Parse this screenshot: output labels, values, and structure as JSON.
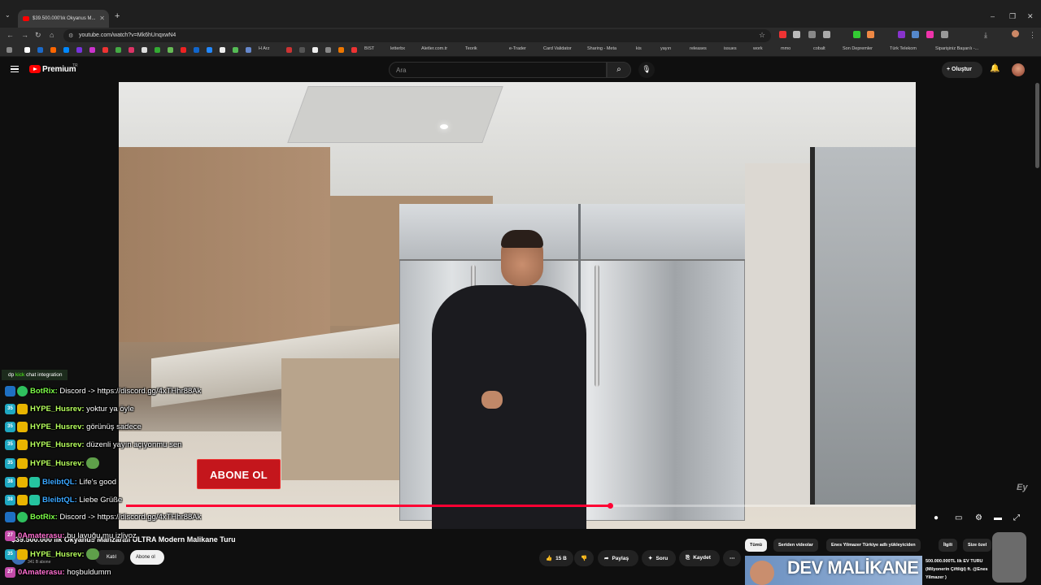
{
  "browser": {
    "tab_title": "$39.500.000'lık Okyanus M...",
    "url": "youtube.com/watch?v=Mk6hUnqxwN4",
    "bookmarks": [
      "H Arz",
      "BIST",
      "letterbx",
      "Aletler.com.tr",
      "Teorik",
      "e-Trader",
      "Card Validator",
      "Sharing - Meta",
      "kis",
      "yayın",
      "releases",
      "issues",
      "work",
      "mmo",
      "cobalt",
      "Son Depremler",
      "Türk Telekom",
      "Siparişiniz Başarılı -..."
    ]
  },
  "youtube": {
    "logo": "Premium",
    "logo_region": "TR",
    "search_placeholder": "Ara",
    "create_label": "Oluştur"
  },
  "player": {
    "subscribe_overlay": "ABONE OL",
    "watermark": "Ey",
    "progress": 0.617
  },
  "video": {
    "title": "$39.500.000'lık Okyanus Manzaralı ULTRA Modern Malikane Turu",
    "subscribers": "341 B abone",
    "join_label": "Katıl",
    "subscribe_label": "Abone ol",
    "likes": "15 B",
    "share_label": "Paylaş",
    "ask_label": "Soru",
    "save_label": "Kaydet"
  },
  "side": {
    "chips": [
      "Tümü",
      "Seriden videolar",
      "Enes Yilmazer Türkiye adlı yükleyiciden",
      "İlgili",
      "Size özel"
    ],
    "thumb_text": "DEV MALİKANE",
    "next_title": "500.000.000TL lik EV TURU (Milyonerin Çiftliği) ft. @Enes Yilmazer )"
  },
  "chat": {
    "integration_label_pre": "dp",
    "integration_label_kick": "kick",
    "integration_label_post": "chat integration",
    "messages": [
      {
        "user": "BotRix:",
        "text": "Discord -> https://discord.gg/4xTHhr88Ak",
        "badge": ""
      },
      {
        "user": "HYPE_Husrev:",
        "text": "yoktur ya öyle",
        "badge": "35"
      },
      {
        "user": "HYPE_Husrev:",
        "text": "görünüş sadece",
        "badge": "35"
      },
      {
        "user": "HYPE_Husrev:",
        "text": "düzenli yayın açıyonmu sen",
        "badge": "35"
      },
      {
        "user": "HYPE_Husrev:",
        "text": "",
        "badge": "35"
      },
      {
        "user": "BleibtQL:",
        "text": "Life's good",
        "badge": "38"
      },
      {
        "user": "BleibtQL:",
        "text": "Liebe Grüße",
        "badge": "38"
      },
      {
        "user": "BotRix:",
        "text": "Discord -> https://discord.gg/4xTHhr88Ak",
        "badge": ""
      },
      {
        "user": "0Amaterasu:",
        "text": "bu lavuğu mu izliyoz",
        "badge": "27"
      },
      {
        "user": "HYPE_Husrev:",
        "text": "",
        "badge": "35"
      },
      {
        "user": "0Amaterasu:",
        "text": "hoşbuldumm",
        "badge": "27"
      }
    ]
  }
}
